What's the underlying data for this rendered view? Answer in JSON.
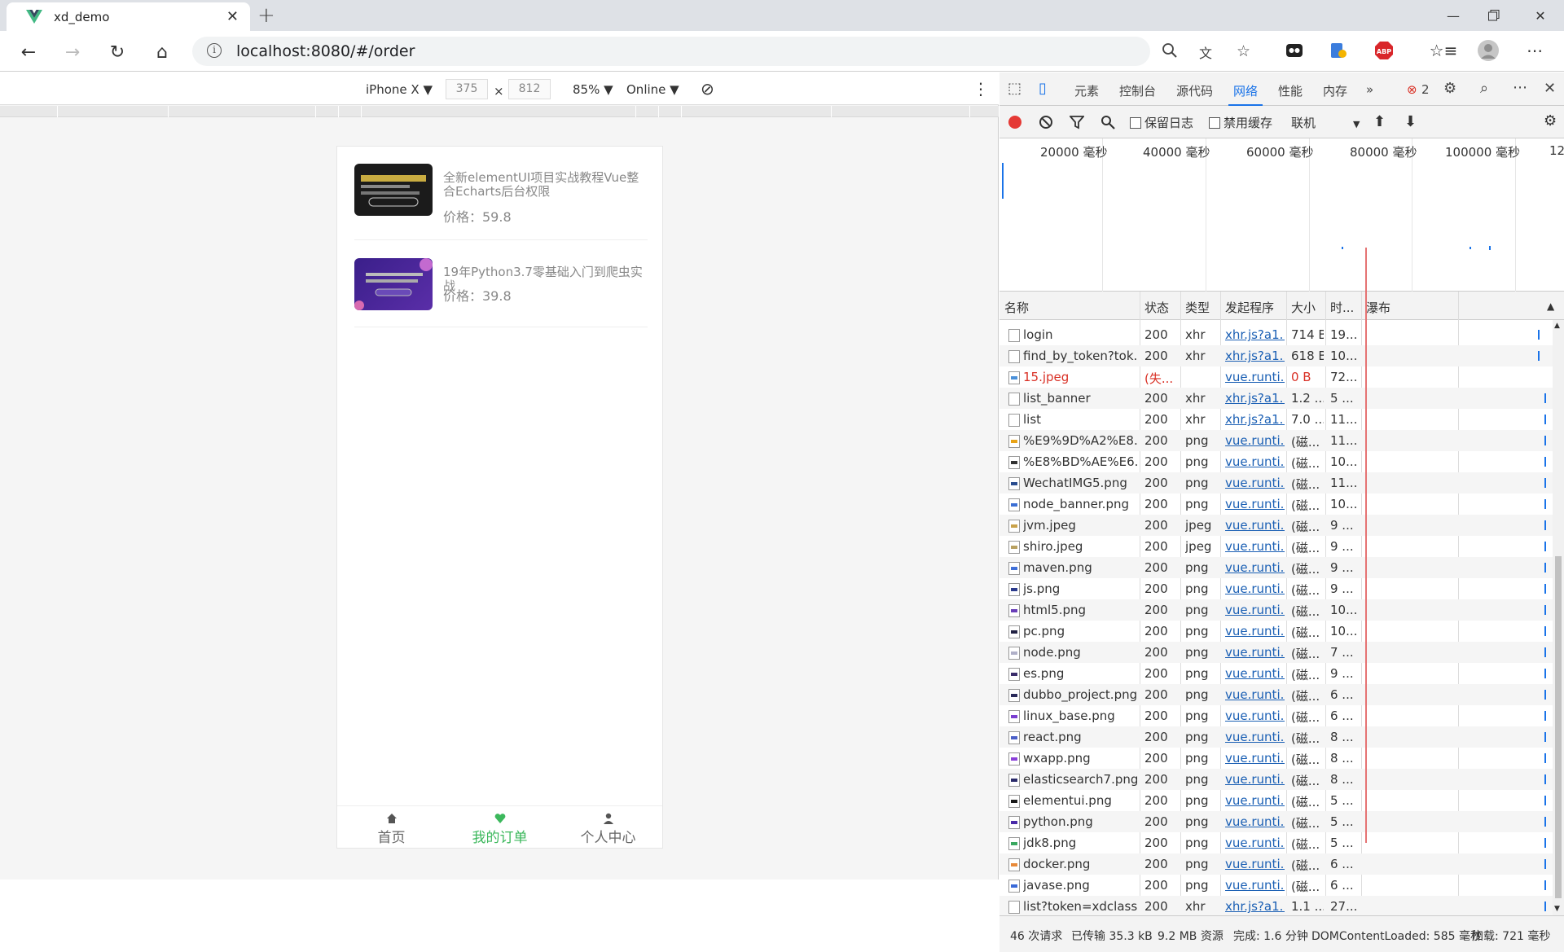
{
  "browser": {
    "tab_title": "xd_demo",
    "url": "localhost:8080/#/order",
    "abp_label": "ABP"
  },
  "device_toolbar": {
    "device": "iPhone X ▼",
    "width": "375",
    "times": "×",
    "height": "812",
    "zoom": "85% ▼",
    "network": "Online ▼"
  },
  "page": {
    "orders": [
      {
        "title": "全新elementUI项目实战教程Vue整合Echarts后台权限",
        "price": "价格：59.8"
      },
      {
        "title": "19年Python3.7零基础入门到爬虫实战",
        "price": "价格：39.8"
      }
    ],
    "bottom_nav": [
      {
        "label": "首页",
        "icon": "home-icon"
      },
      {
        "label": "我的订单",
        "icon": "heart-icon"
      },
      {
        "label": "个人中心",
        "icon": "user-icon"
      }
    ],
    "active_nav_color": "#3cb85c"
  },
  "devtools": {
    "tabs": [
      "元素",
      "控制台",
      "源代码",
      "网络",
      "性能",
      "内存",
      "»"
    ],
    "active_tab": "网络",
    "error_count": "2",
    "toolbar": {
      "preserve_log": "保留日志",
      "disable_cache": "禁用缓存",
      "throttle": "联机"
    },
    "overview_ticks": [
      "20000 毫秒",
      "40000 毫秒",
      "60000 毫秒",
      "80000 毫秒",
      "100000 毫秒",
      "12"
    ],
    "columns": [
      "名称",
      "状态",
      "类型",
      "发起程序",
      "大小",
      "时...",
      "瀑布"
    ],
    "requests": [
      {
        "name": "login",
        "status": "200",
        "type": "xhr",
        "initiator": "xhr.js?a1...",
        "size": "714 B",
        "time": "19...",
        "icon": "doc"
      },
      {
        "name": "find_by_token?tok...",
        "status": "200",
        "type": "xhr",
        "initiator": "xhr.js?a1...",
        "size": "618 B",
        "time": "10...",
        "icon": "doc"
      },
      {
        "name": "15.jpeg",
        "status": "(失...",
        "type": "",
        "initiator": "vue.runti...",
        "size": "0 B",
        "time": "72...",
        "icon": "img-broken",
        "error": true
      },
      {
        "name": "list_banner",
        "status": "200",
        "type": "xhr",
        "initiator": "xhr.js?a1...",
        "size": "1.2 ...",
        "time": "5 ...",
        "icon": "doc"
      },
      {
        "name": "list",
        "status": "200",
        "type": "xhr",
        "initiator": "xhr.js?a1...",
        "size": "7.0 ...",
        "time": "11...",
        "icon": "doc"
      },
      {
        "name": "%E9%9D%A2%E8...",
        "status": "200",
        "type": "png",
        "initiator": "vue.runti...",
        "size": "(磁...",
        "time": "11...",
        "icon": "#e8a317"
      },
      {
        "name": "%E8%BD%AE%E6...",
        "status": "200",
        "type": "png",
        "initiator": "vue.runti...",
        "size": "(磁...",
        "time": "10...",
        "icon": "#333333"
      },
      {
        "name": "WechatIMG5.png",
        "status": "200",
        "type": "png",
        "initiator": "vue.runti...",
        "size": "(磁...",
        "time": "11...",
        "icon": "#2a4d8f"
      },
      {
        "name": "node_banner.png",
        "status": "200",
        "type": "png",
        "initiator": "vue.runti...",
        "size": "(磁...",
        "time": "10...",
        "icon": "#3b6fd4"
      },
      {
        "name": "jvm.jpeg",
        "status": "200",
        "type": "jpeg",
        "initiator": "vue.runti...",
        "size": "(磁...",
        "time": "9 ...",
        "icon": "#c9a24a"
      },
      {
        "name": "shiro.jpeg",
        "status": "200",
        "type": "jpeg",
        "initiator": "vue.runti...",
        "size": "(磁...",
        "time": "9 ...",
        "icon": "#b8a060"
      },
      {
        "name": "maven.png",
        "status": "200",
        "type": "png",
        "initiator": "vue.runti...",
        "size": "(磁...",
        "time": "9 ...",
        "icon": "#3f6fd8"
      },
      {
        "name": "js.png",
        "status": "200",
        "type": "png",
        "initiator": "vue.runti...",
        "size": "(磁...",
        "time": "9 ...",
        "icon": "#2b3a8c"
      },
      {
        "name": "html5.png",
        "status": "200",
        "type": "png",
        "initiator": "vue.runti...",
        "size": "(磁...",
        "time": "10...",
        "icon": "#6a3fb8"
      },
      {
        "name": "pc.png",
        "status": "200",
        "type": "png",
        "initiator": "vue.runti...",
        "size": "(磁...",
        "time": "10...",
        "icon": "#222244"
      },
      {
        "name": "node.png",
        "status": "200",
        "type": "png",
        "initiator": "vue.runti...",
        "size": "(磁...",
        "time": "7 ...",
        "icon": "#b0b0c8"
      },
      {
        "name": "es.png",
        "status": "200",
        "type": "png",
        "initiator": "vue.runti...",
        "size": "(磁...",
        "time": "9 ...",
        "icon": "#3a2c6a"
      },
      {
        "name": "dubbo_project.png",
        "status": "200",
        "type": "png",
        "initiator": "vue.runti...",
        "size": "(磁...",
        "time": "6 ...",
        "icon": "#2a2a5a"
      },
      {
        "name": "linux_base.png",
        "status": "200",
        "type": "png",
        "initiator": "vue.runti...",
        "size": "(磁...",
        "time": "6 ...",
        "icon": "#7a3fd0"
      },
      {
        "name": "react.png",
        "status": "200",
        "type": "png",
        "initiator": "vue.runti...",
        "size": "(磁...",
        "time": "8 ...",
        "icon": "#4a5fc8"
      },
      {
        "name": "wxapp.png",
        "status": "200",
        "type": "png",
        "initiator": "vue.runti...",
        "size": "(磁...",
        "time": "8 ...",
        "icon": "#8a3fd8"
      },
      {
        "name": "elasticsearch7.png",
        "status": "200",
        "type": "png",
        "initiator": "vue.runti...",
        "size": "(磁...",
        "time": "8 ...",
        "icon": "#2a2a6a"
      },
      {
        "name": "elementui.png",
        "status": "200",
        "type": "png",
        "initiator": "vue.runti...",
        "size": "(磁...",
        "time": "5 ...",
        "icon": "#1b1b1b"
      },
      {
        "name": "python.png",
        "status": "200",
        "type": "png",
        "initiator": "vue.runti...",
        "size": "(磁...",
        "time": "5 ...",
        "icon": "#4a2aa8"
      },
      {
        "name": "jdk8.png",
        "status": "200",
        "type": "png",
        "initiator": "vue.runti...",
        "size": "(磁...",
        "time": "5 ...",
        "icon": "#3aa860"
      },
      {
        "name": "docker.png",
        "status": "200",
        "type": "png",
        "initiator": "vue.runti...",
        "size": "(磁...",
        "time": "6 ...",
        "icon": "#e88a3a"
      },
      {
        "name": "javase.png",
        "status": "200",
        "type": "png",
        "initiator": "vue.runti...",
        "size": "(磁...",
        "time": "6 ...",
        "icon": "#3a6ad8"
      },
      {
        "name": "list?token=xdclass...",
        "status": "200",
        "type": "xhr",
        "initiator": "xhr.js?a1...",
        "size": "1.1 ...",
        "time": "27...",
        "icon": "doc"
      }
    ],
    "status_bar": {
      "requests": "46 次请求",
      "transferred": "已传输 35.3 kB",
      "resources": "9.2 MB 资源",
      "finish": "完成: 1.6 分钟",
      "dcl": "DOMContentLoaded: 585 毫秒",
      "load": "加载: 721 毫秒"
    }
  }
}
